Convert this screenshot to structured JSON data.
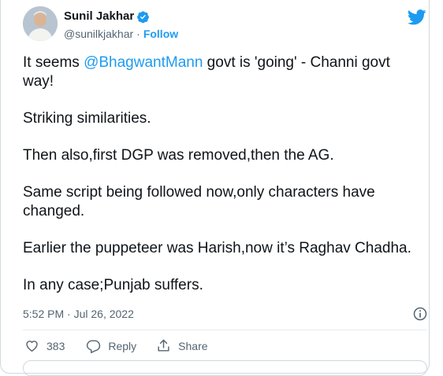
{
  "author": {
    "name": "Sunil Jakhar",
    "handle": "@sunilkjakhar",
    "separator": "·",
    "follow_label": "Follow"
  },
  "tweet": {
    "mention": "@BhagwantMann",
    "line1_prefix": "It seems ",
    "line1_suffix": " govt is 'going' - Channi govt way!",
    "paragraphs": [
      "Striking similarities.",
      "Then also,first DGP was removed,then the AG.",
      "Same script being followed now,only characters have changed.",
      "Earlier the puppeteer was Harish,now it’s Raghav Chadha.",
      "In any case;Punjab suffers."
    ],
    "timestamp": "5:52 PM · Jul 26, 2022"
  },
  "actions": {
    "like_count": "383",
    "reply_label": "Reply",
    "share_label": "Share"
  },
  "icons": {
    "verified": "verified-badge-icon",
    "brand": "twitter-bird-icon",
    "info": "info-icon",
    "like": "heart-icon",
    "reply": "reply-bubble-icon",
    "share": "share-icon"
  },
  "colors": {
    "accent": "#1d9bf0",
    "text": "#0f1419",
    "secondary": "#536471",
    "border": "#cfd9de"
  }
}
